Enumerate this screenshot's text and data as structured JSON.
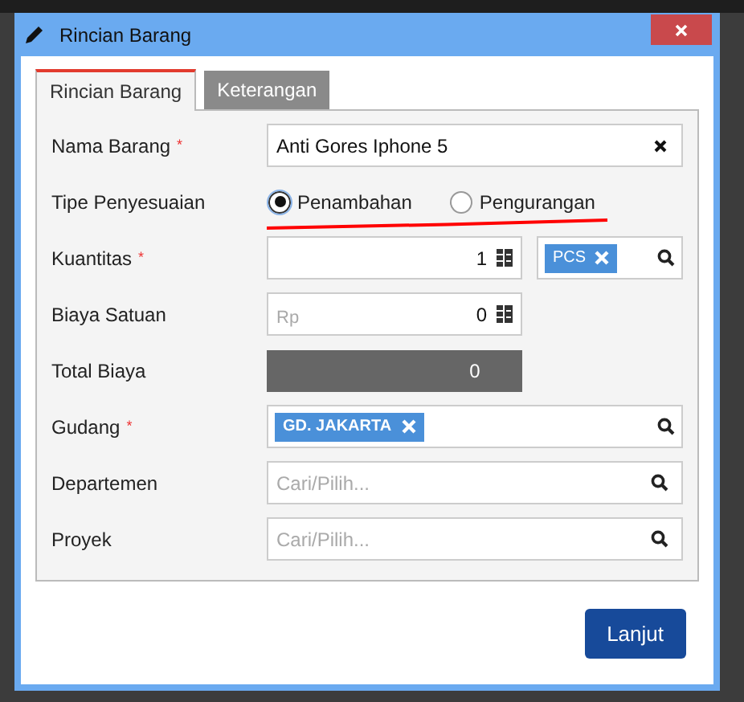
{
  "dialog": {
    "title": "Rincian Barang"
  },
  "tabs": [
    {
      "label": "Rincian Barang",
      "selected": true
    },
    {
      "label": "Keterangan",
      "selected": false
    }
  ],
  "fields": [
    {
      "kind": "clearable",
      "label": "Nama Barang",
      "required_mark": "*",
      "value": "Anti Gores Iphone 5"
    },
    {
      "kind": "radio",
      "label": "Tipe Penyesuaian",
      "options": [
        {
          "label": "Penambahan",
          "selected": true
        },
        {
          "label": "Pengurangan",
          "selected": false
        }
      ]
    },
    {
      "kind": "quantity",
      "label": "Kuantitas",
      "required_mark": "*",
      "value": "1",
      "unit_tag": "PCS"
    },
    {
      "kind": "currency",
      "label": "Biaya Satuan",
      "prefix": "Rp",
      "value": "0"
    },
    {
      "kind": "total",
      "label": "Total Biaya",
      "value": "0"
    },
    {
      "kind": "lookup",
      "label": "Gudang",
      "required_mark": "*",
      "tag": "GD. JAKARTA"
    },
    {
      "kind": "lookup",
      "label": "Departemen",
      "placeholder": "Cari/Pilih..."
    },
    {
      "kind": "lookup",
      "label": "Proyek",
      "placeholder": "Cari/Pilih..."
    }
  ],
  "buttons": [
    {
      "label": "Lanjut"
    }
  ]
}
